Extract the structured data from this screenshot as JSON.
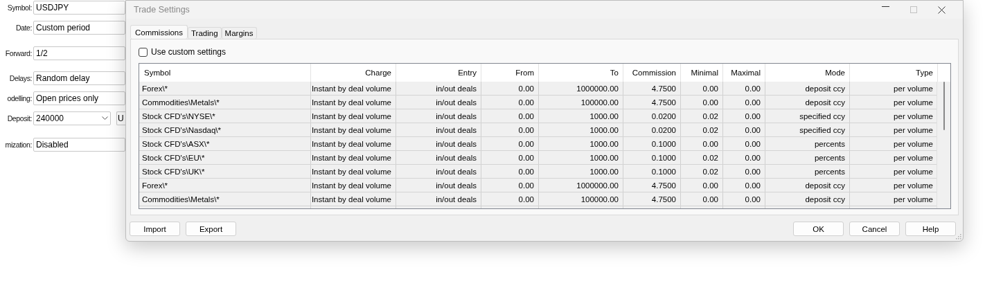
{
  "background_form": {
    "rows": [
      {
        "label": "Symbol:",
        "kind": "text",
        "value": "USDJPY"
      },
      {
        "label": "Date:",
        "kind": "text",
        "value": "Custom period"
      },
      {
        "label": "Forward:",
        "kind": "text",
        "value": "1/2"
      },
      {
        "label": "Delays:",
        "kind": "text",
        "value": "Random delay"
      },
      {
        "label": "odelling:",
        "kind": "text",
        "value": "Open prices only"
      },
      {
        "label": "Deposit:",
        "kind": "combo",
        "value": "240000",
        "extra": "U"
      },
      {
        "label": "mization:",
        "kind": "text",
        "value": "Disabled"
      }
    ]
  },
  "window": {
    "title": "Trade Settings",
    "maximize_disabled": true
  },
  "tabs": [
    {
      "label": "Commissions",
      "selected": true
    },
    {
      "label": "Trading",
      "selected": false
    },
    {
      "label": "Margins",
      "selected": false
    }
  ],
  "use_custom_settings": {
    "label": "Use custom settings",
    "checked": false
  },
  "table": {
    "columns": [
      "Symbol",
      "Charge",
      "Entry",
      "From",
      "To",
      "Commission",
      "Minimal",
      "Maximal",
      "Mode",
      "Type"
    ],
    "rows": [
      [
        "Forex\\*",
        "Instant by deal volume",
        "in/out deals",
        "0.00",
        "1000000.00",
        "4.7500",
        "0.00",
        "0.00",
        "deposit ccy",
        "per volume"
      ],
      [
        "Commodities\\Metals\\*",
        "Instant by deal volume",
        "in/out deals",
        "0.00",
        "100000.00",
        "4.7500",
        "0.00",
        "0.00",
        "deposit ccy",
        "per volume"
      ],
      [
        "Stock CFD's\\NYSE\\*",
        "Instant by deal volume",
        "in/out deals",
        "0.00",
        "1000.00",
        "0.0200",
        "0.02",
        "0.00",
        "specified ccy",
        "per volume"
      ],
      [
        "Stock CFD's\\Nasdaq\\*",
        "Instant by deal volume",
        "in/out deals",
        "0.00",
        "1000.00",
        "0.0200",
        "0.02",
        "0.00",
        "specified ccy",
        "per volume"
      ],
      [
        "Stock CFD's\\ASX\\*",
        "Instant by deal volume",
        "in/out deals",
        "0.00",
        "1000.00",
        "0.1000",
        "0.00",
        "0.00",
        "percents",
        "per volume"
      ],
      [
        "Stock CFD's\\EU\\*",
        "Instant by deal volume",
        "in/out deals",
        "0.00",
        "1000.00",
        "0.1000",
        "0.02",
        "0.00",
        "percents",
        "per volume"
      ],
      [
        "Stock CFD's\\UK\\*",
        "Instant by deal volume",
        "in/out deals",
        "0.00",
        "1000.00",
        "0.1000",
        "0.02",
        "0.00",
        "percents",
        "per volume"
      ],
      [
        "Forex\\*",
        "Instant by deal volume",
        "in/out deals",
        "0.00",
        "1000000.00",
        "4.7500",
        "0.00",
        "0.00",
        "deposit ccy",
        "per volume"
      ],
      [
        "Commodities\\Metals\\*",
        "Instant by deal volume",
        "in/out deals",
        "0.00",
        "100000.00",
        "4.7500",
        "0.00",
        "0.00",
        "deposit ccy",
        "per volume"
      ]
    ]
  },
  "buttons_left": [
    "Import",
    "Export"
  ],
  "buttons_right": [
    "OK",
    "Cancel",
    "Help"
  ]
}
